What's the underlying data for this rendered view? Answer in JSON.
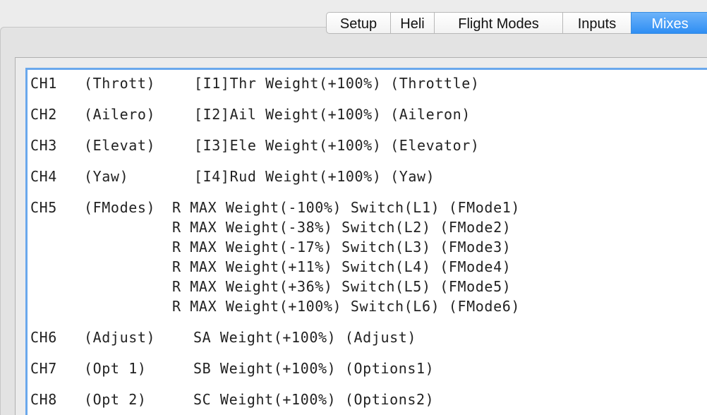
{
  "tabs": [
    {
      "label": "Setup",
      "active": false
    },
    {
      "label": "Heli",
      "active": false
    },
    {
      "label": "Flight Modes",
      "active": false
    },
    {
      "label": "Inputs",
      "active": false
    },
    {
      "label": "Mixes",
      "active": true
    }
  ],
  "colors": {
    "active_tab": "#3a8ff3",
    "list_focus_border": "#6aa8ec"
  },
  "mixes": [
    {
      "channel": "CH1",
      "name": "(Thrott)",
      "lines": [
        "[I1]Thr Weight(+100%) (Throttle)"
      ]
    },
    {
      "channel": "CH2",
      "name": "(Ailero)",
      "lines": [
        "[I2]Ail Weight(+100%) (Aileron)"
      ]
    },
    {
      "channel": "CH3",
      "name": "(Elevat)",
      "lines": [
        "[I3]Ele Weight(+100%) (Elevator)"
      ]
    },
    {
      "channel": "CH4",
      "name": "(Yaw)",
      "lines": [
        "[I4]Rud Weight(+100%) (Yaw)"
      ]
    },
    {
      "channel": "CH5",
      "name": "(FModes)",
      "lines": [
        "R MAX Weight(-100%) Switch(L1) (FMode1)",
        "R MAX Weight(-38%) Switch(L2) (FMode2)",
        "R MAX Weight(-17%) Switch(L3) (FMode3)",
        "R MAX Weight(+11%) Switch(L4) (FMode4)",
        "R MAX Weight(+36%) Switch(L5) (FMode5)",
        "R MAX Weight(+100%) Switch(L6) (FMode6)"
      ]
    },
    {
      "channel": "CH6",
      "name": "(Adjust)",
      "lines": [
        "SA Weight(+100%) (Adjust)"
      ]
    },
    {
      "channel": "CH7",
      "name": "(Opt 1)",
      "lines": [
        "SB Weight(+100%) (Options1)"
      ]
    },
    {
      "channel": "CH8",
      "name": "(Opt 2)",
      "lines": [
        "SC Weight(+100%) (Options2)"
      ]
    }
  ]
}
